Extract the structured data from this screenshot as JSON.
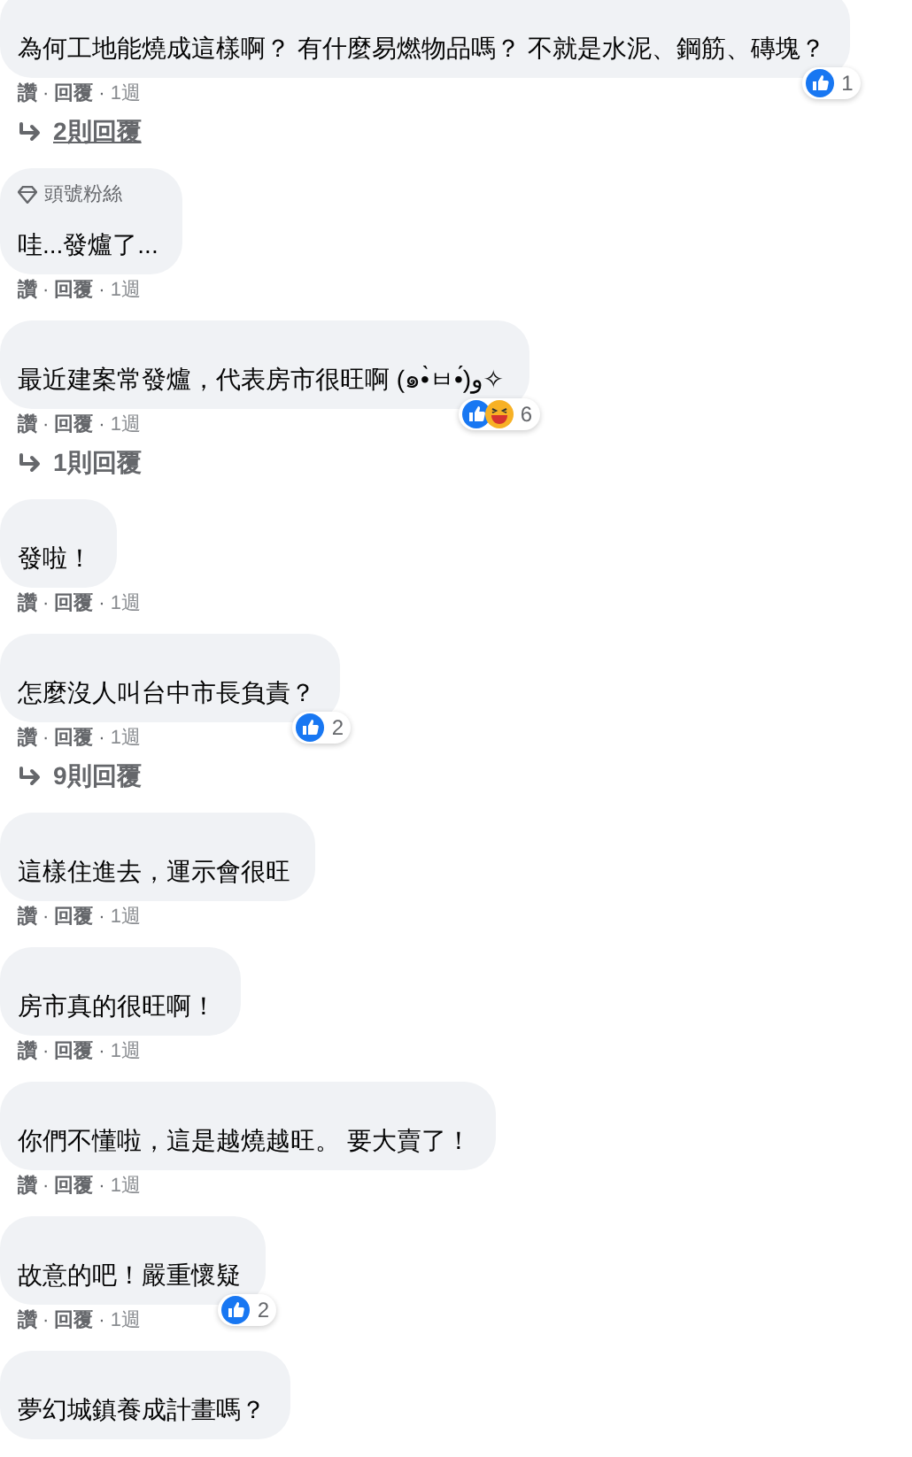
{
  "comments": [
    {
      "text": "為何工地能燒成這樣啊？ 有什麼易燃物品嗎？ 不就是水泥、鋼筋、磚塊？",
      "reactions": {
        "icons": [
          {
            "kind": "like"
          }
        ],
        "count": "1"
      },
      "meta": [
        {
          "kind": "link",
          "text": "讚"
        },
        {
          "kind": "dot",
          "text": "·"
        },
        {
          "kind": "link",
          "text": "回覆"
        },
        {
          "kind": "dot",
          "text": "·"
        },
        {
          "kind": "time",
          "text": "1週"
        }
      ],
      "replies": {
        "label": "2則回覆",
        "underlined": true
      }
    },
    {
      "badge": "頭號粉絲",
      "text": "哇...發爐了...",
      "meta": [
        {
          "kind": "link",
          "text": "讚"
        },
        {
          "kind": "dot",
          "text": "·"
        },
        {
          "kind": "link",
          "text": "回覆"
        },
        {
          "kind": "dot",
          "text": "·"
        },
        {
          "kind": "time",
          "text": "1週"
        }
      ]
    },
    {
      "text": "最近建案常發爐，代表房市很旺啊 (๑•̀ㅂ•́)و✧",
      "reactions": {
        "icons": [
          {
            "kind": "like"
          },
          {
            "kind": "haha"
          }
        ],
        "count": "6"
      },
      "meta": [
        {
          "kind": "link",
          "text": "讚"
        },
        {
          "kind": "dot",
          "text": "·"
        },
        {
          "kind": "link",
          "text": "回覆"
        },
        {
          "kind": "dot",
          "text": "·"
        },
        {
          "kind": "time",
          "text": "1週"
        }
      ],
      "replies": {
        "label": "1則回覆",
        "underlined": false
      }
    },
    {
      "text": "發啦！",
      "meta": [
        {
          "kind": "link",
          "text": "讚"
        },
        {
          "kind": "dot",
          "text": "·"
        },
        {
          "kind": "link",
          "text": "回覆"
        },
        {
          "kind": "dot",
          "text": "·"
        },
        {
          "kind": "time",
          "text": "1週"
        }
      ]
    },
    {
      "text": "怎麼沒人叫台中市長負責？",
      "reactions": {
        "icons": [
          {
            "kind": "like"
          }
        ],
        "count": "2"
      },
      "meta": [
        {
          "kind": "link",
          "text": "讚"
        },
        {
          "kind": "dot",
          "text": "·"
        },
        {
          "kind": "link",
          "text": "回覆"
        },
        {
          "kind": "dot",
          "text": "·"
        },
        {
          "kind": "time",
          "text": "1週"
        }
      ],
      "replies": {
        "label": "9則回覆",
        "underlined": false
      }
    },
    {
      "text": "這樣住進去，運示會很旺",
      "meta": [
        {
          "kind": "link",
          "text": "讚"
        },
        {
          "kind": "dot",
          "text": "·"
        },
        {
          "kind": "link",
          "text": "回覆"
        },
        {
          "kind": "dot",
          "text": "·"
        },
        {
          "kind": "time",
          "text": "1週"
        }
      ]
    },
    {
      "text": "房市真的很旺啊！",
      "meta": [
        {
          "kind": "link",
          "text": "讚"
        },
        {
          "kind": "dot",
          "text": "·"
        },
        {
          "kind": "link",
          "text": "回覆"
        },
        {
          "kind": "dot",
          "text": "·"
        },
        {
          "kind": "time",
          "text": "1週"
        }
      ]
    },
    {
      "text": "你們不懂啦，這是越燒越旺。 要大賣了！",
      "meta": [
        {
          "kind": "link",
          "text": "讚"
        },
        {
          "kind": "dot",
          "text": "·"
        },
        {
          "kind": "link",
          "text": "回覆"
        },
        {
          "kind": "dot",
          "text": "·"
        },
        {
          "kind": "time",
          "text": "1週"
        }
      ]
    },
    {
      "text": "故意的吧！嚴重懷疑",
      "reactions": {
        "icons": [
          {
            "kind": "like"
          }
        ],
        "count": "2"
      },
      "meta": [
        {
          "kind": "link",
          "text": "讚"
        },
        {
          "kind": "dot",
          "text": "·"
        },
        {
          "kind": "link",
          "text": "回覆"
        },
        {
          "kind": "dot",
          "text": "·"
        },
        {
          "kind": "time",
          "text": "1週"
        }
      ]
    },
    {
      "text": "夢幻城鎮養成計畫嗎？"
    }
  ]
}
